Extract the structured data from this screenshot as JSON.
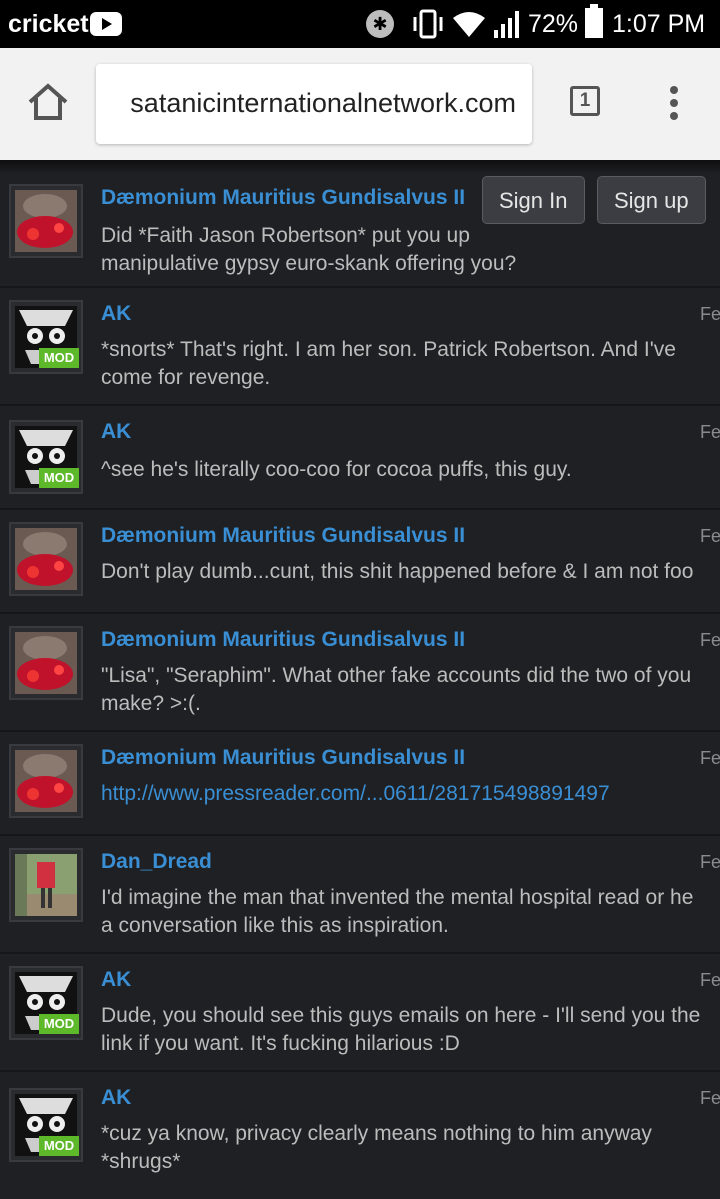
{
  "status_bar": {
    "carrier": "cricket",
    "battery_percent": "72%",
    "time": "1:07 PM",
    "icons": [
      "youtube-icon",
      "bluetooth-icon",
      "vibrate-icon",
      "wifi-icon",
      "signal-icon",
      "battery-icon"
    ]
  },
  "browser": {
    "url": "satanicinternationalnetwork.com",
    "tab_count": "1"
  },
  "auth": {
    "sign_in": "Sign In",
    "sign_up": "Sign up"
  },
  "colors": {
    "background": "#1f2023",
    "author": "#3a8fd4",
    "text": "#bcbcbc",
    "mod_badge": "#5db82a"
  },
  "messages": [
    {
      "author": "Dæmonium Mauritius Gundisalvus II",
      "date": "",
      "body": "Did *Faith Jason Robertson* put you up\nmanipulative gypsy euro-skank offering you?",
      "mod": false,
      "avatar": "bloody-avatar"
    },
    {
      "author": "AK",
      "date": "Fe",
      "body": "*snorts* That's right. I am her son. Patrick Robertson. And I've\ncome for revenge.",
      "mod": true,
      "mod_label": "MOD",
      "avatar": "skull-avatar"
    },
    {
      "author": "AK",
      "date": "Fe",
      "body": "^see he's literally coo-coo for cocoa puffs, this guy.",
      "mod": true,
      "mod_label": "MOD",
      "avatar": "skull-avatar"
    },
    {
      "author": "Dæmonium Mauritius Gundisalvus II",
      "date": "Fe",
      "body": "Don't play dumb...cunt, this shit happened before & I am not foo",
      "mod": false,
      "avatar": "bloody-avatar"
    },
    {
      "author": "Dæmonium Mauritius Gundisalvus II",
      "date": "Fe",
      "body": "\"Lisa\", \"Seraphim\". What other fake accounts did the two of you\nmake? >:(.",
      "mod": false,
      "avatar": "bloody-avatar"
    },
    {
      "author": "Dæmonium Mauritius Gundisalvus II",
      "date": "Fe",
      "body": "http://www.pressreader.com/...0611/281715498891497",
      "is_link": true,
      "mod": false,
      "avatar": "bloody-avatar"
    },
    {
      "author": "Dan_Dread",
      "date": "Fe",
      "body": "I'd imagine the man that invented the mental hospital read or he\na conversation like this as inspiration.",
      "mod": false,
      "avatar": "photo-avatar"
    },
    {
      "author": "AK",
      "date": "Fe",
      "body": "Dude, you should see this guys emails on here - I'll send you the\nlink if you want. It's fucking hilarious :D",
      "mod": true,
      "mod_label": "MOD",
      "avatar": "skull-avatar"
    },
    {
      "author": "AK",
      "date": "Fe",
      "body": "*cuz ya know, privacy clearly means nothing to him anyway\n*shrugs*",
      "mod": true,
      "mod_label": "MOD",
      "avatar": "skull-avatar"
    }
  ]
}
